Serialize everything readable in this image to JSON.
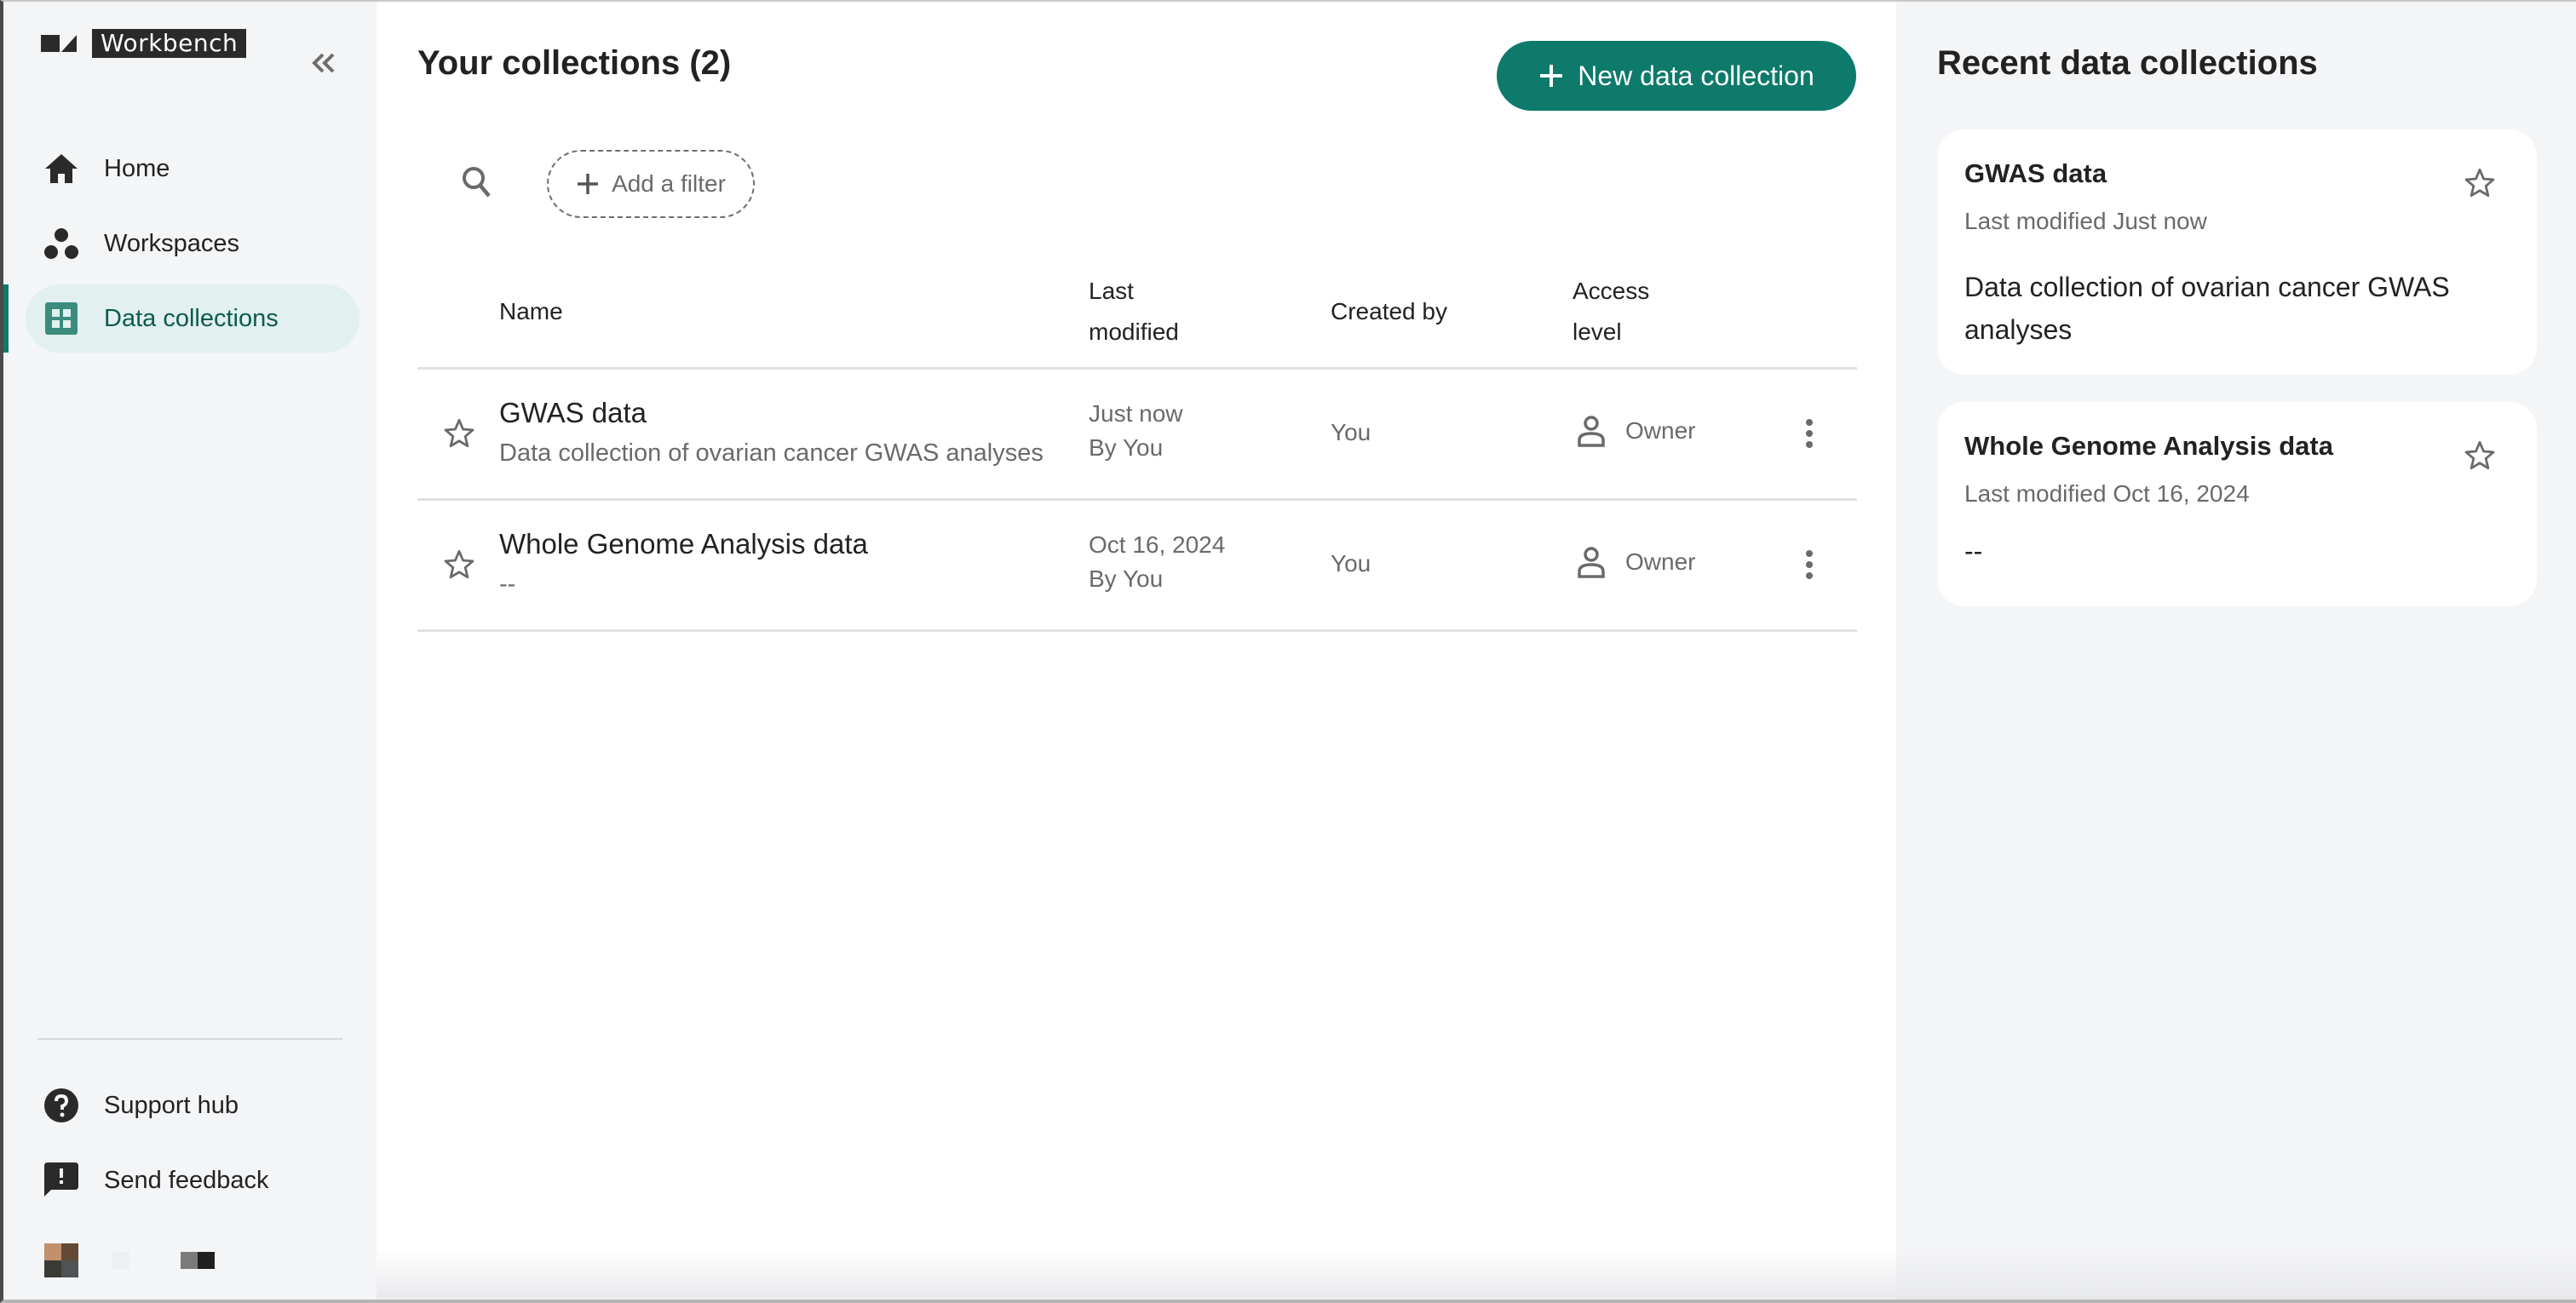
{
  "app": {
    "name": "Workbench",
    "accent_color": "#0D7A6B",
    "active_nav_bg": "#E2F0F0"
  },
  "sidebar": {
    "collapse_icon": "double-chevron-left-icon",
    "items": [
      {
        "label": "Home",
        "icon": "home-icon",
        "active": false
      },
      {
        "label": "Workspaces",
        "icon": "workspaces-icon",
        "active": false
      },
      {
        "label": "Data collections",
        "icon": "grid-icon",
        "active": true
      }
    ],
    "bottom_items": [
      {
        "label": "Support hub",
        "icon": "help-circle-icon"
      },
      {
        "label": "Send feedback",
        "icon": "feedback-icon"
      }
    ]
  },
  "main": {
    "title": "Your collections (2)",
    "new_button_label": "New data collection",
    "filter_label": "Add a filter",
    "table": {
      "columns": {
        "name": "Name",
        "last_modified_line1": "Last",
        "last_modified_line2": "modified",
        "created_by": "Created by",
        "access_line1": "Access",
        "access_line2": "level"
      },
      "rows": [
        {
          "name": "GWAS data",
          "description": "Data collection of ovarian cancer GWAS analyses",
          "modified": "Just now",
          "modified_by": "By You",
          "created_by": "You",
          "access": "Owner"
        },
        {
          "name": "Whole Genome Analysis data",
          "description": "--",
          "modified": "Oct 16, 2024",
          "modified_by": "By You",
          "created_by": "You",
          "access": "Owner"
        }
      ]
    }
  },
  "recent": {
    "title": "Recent data collections",
    "cards": [
      {
        "title": "GWAS data",
        "modified": "Last modified Just now",
        "description": "Data collection of ovarian cancer GWAS analyses"
      },
      {
        "title": "Whole Genome Analysis data",
        "modified": "Last modified Oct 16, 2024",
        "description": "--"
      }
    ]
  }
}
